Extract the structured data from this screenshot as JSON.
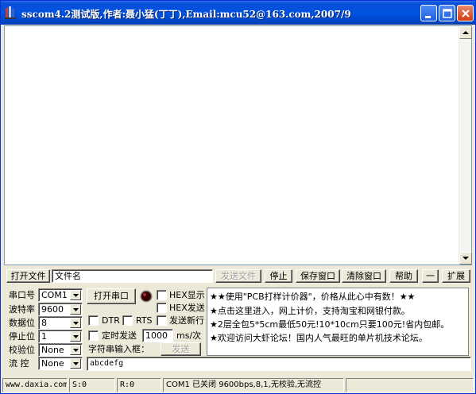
{
  "window": {
    "title": "sscom4.2测试版,作者:聂小猛(丁丁),Email:mcu52@163.com,2007/9"
  },
  "file_row": {
    "open_file": "打开文件",
    "filename": "文件名",
    "send_file": "发送文件",
    "stop": "停止",
    "save_window": "保存窗口",
    "clear_window": "清除窗口",
    "help": "帮助",
    "dash": "一",
    "expand": "扩展"
  },
  "port": {
    "port_label": "串口号",
    "port_value": "COM1",
    "baud_label": "波特率",
    "baud_value": "9600",
    "databits_label": "数据位",
    "databits_value": "8",
    "stopbits_label": "停止位",
    "stopbits_value": "1",
    "parity_label": "校验位",
    "parity_value": "None",
    "flow_label": "流 控",
    "flow_value": "None"
  },
  "controls": {
    "open_port": "打开串口",
    "hex_display": "HEX显示",
    "hex_send": "HEX发送",
    "dtr": "DTR",
    "rts": "RTS",
    "send_newline": "发送新行",
    "timed_send": "定时发送",
    "interval_value": "1000",
    "interval_unit": "ms/次",
    "input_label": "字符串输入框：",
    "send": "发送",
    "input_value": "abcdefg"
  },
  "promo": {
    "line1": "★★使用\"PCB打样计价器\"，价格从此心中有数！★★",
    "line2": "★点击这里进入，网上计价，支持淘宝和网银付款。",
    "line3": "★2层全包5*5cm最低50元!10*10cm只要100元!省内包邮。",
    "line4": "★欢迎访问大虾论坛！国内人气最旺的单片机技术论坛。"
  },
  "status": {
    "site": "www.daxia.com",
    "sent": "S:0",
    "received": "R:0",
    "port_status": "COM1 已关闭  9600bps,8,1,无校验,无流控"
  },
  "colors": {
    "title_bar": "#0053e1",
    "window_bg": "#ece9d8",
    "close_button": "#cf3c12",
    "led": "#3a0000"
  }
}
